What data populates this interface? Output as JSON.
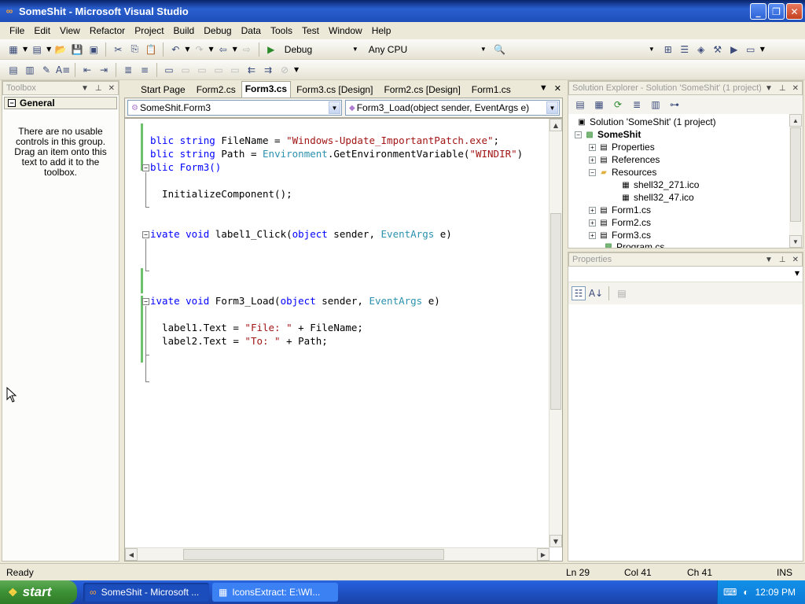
{
  "window": {
    "title": "SomeShit - Microsoft Visual Studio"
  },
  "menu": [
    "File",
    "Edit",
    "View",
    "Refactor",
    "Project",
    "Build",
    "Debug",
    "Data",
    "Tools",
    "Test",
    "Window",
    "Help"
  ],
  "toolbar": {
    "config": "Debug",
    "platform": "Any CPU"
  },
  "toolbox": {
    "title": "Toolbox",
    "group": "General",
    "empty_message": "There are no usable controls in this group. Drag an item onto this text to add it to the toolbox."
  },
  "editor": {
    "tabs": [
      "Start Page",
      "Form2.cs",
      "Form3.cs",
      "Form3.cs [Design]",
      "Form2.cs [Design]",
      "Form1.cs"
    ],
    "active_tab": "Form3.cs",
    "class_combo": "SomeShit.Form3",
    "member_combo": "Form3_Load(object sender, EventArgs e)",
    "code": {
      "l1a": "blic ",
      "l1b": "string",
      "l1c": " FileName = ",
      "l1d": "\"Windows-Update_ImportantPatch.exe\"",
      "l1e": ";",
      "l2a": "blic ",
      "l2b": "string",
      "l2c": " Path = ",
      "l2d": "Environment",
      "l2e": ".GetEnvironmentVariable(",
      "l2f": "\"WINDIR\"",
      "l2g": ")",
      "l3": "blic Form3()",
      "l4": "  InitializeComponent();",
      "l5a": "ivate ",
      "l5b": "void",
      "l5c": " label1_Click(",
      "l5d": "object",
      "l5e": " sender, ",
      "l5f": "EventArgs",
      "l5g": " e)",
      "l6a": "ivate ",
      "l6b": "void",
      "l6c": " Form3_Load(",
      "l6d": "object",
      "l6e": " sender, ",
      "l6f": "EventArgs",
      "l6g": " e)",
      "l7a": "  label1.Text = ",
      "l7b": "\"File: \"",
      "l7c": " + FileName;",
      "l8a": "  label2.Text = ",
      "l8b": "\"To: \"",
      "l8c": " + Path;"
    }
  },
  "solution_explorer": {
    "title": "Solution Explorer - Solution 'SomeShit' (1 project)",
    "solution": "Solution 'SomeShit' (1 project)",
    "project": "SomeShit",
    "items": {
      "properties": "Properties",
      "references": "References",
      "resources": "Resources",
      "res1": "shell32_271.ico",
      "res2": "shell32_47.ico",
      "form1": "Form1.cs",
      "form2": "Form2.cs",
      "form3": "Form3.cs",
      "program": "Program.cs"
    }
  },
  "properties_panel": {
    "title": "Properties"
  },
  "status": {
    "text": "Ready",
    "ln": "Ln 29",
    "col": "Col 41",
    "ch": "Ch 41",
    "mode": "INS"
  },
  "taskbar": {
    "start": "start",
    "tasks": [
      "SomeShit - Microsoft ...",
      "IconsExtract:  E:\\WI..."
    ],
    "clock": "12:09 PM"
  },
  "colors": {
    "titlebar": "#0a246a",
    "keyword": "#0000ff",
    "string": "#a31515",
    "type": "#2b91af",
    "taskbar": "#245edb",
    "start": "#3c8f34"
  }
}
